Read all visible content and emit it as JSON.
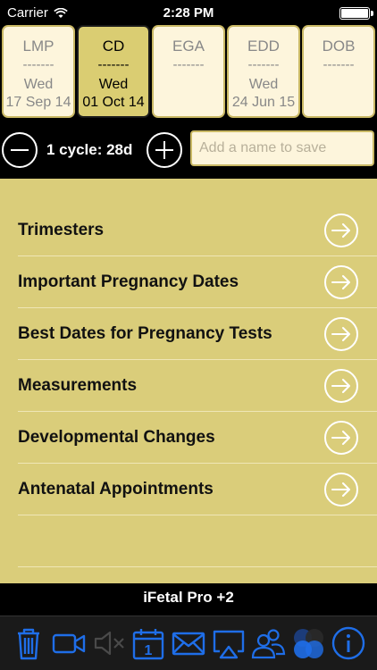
{
  "status_bar": {
    "carrier": "Carrier",
    "time": "2:28 PM"
  },
  "date_tabs": [
    {
      "abbr": "LMP",
      "dash": "-------",
      "day": "Wed",
      "date": "17 Sep 14",
      "active": false
    },
    {
      "abbr": "CD",
      "dash": "-------",
      "day": "Wed",
      "date": "01 Oct 14",
      "active": true
    },
    {
      "abbr": "EGA",
      "dash": "-------",
      "day": "",
      "date": "",
      "active": false
    },
    {
      "abbr": "EDD",
      "dash": "-------",
      "day": "Wed",
      "date": "24 Jun 15",
      "active": false
    },
    {
      "abbr": "DOB",
      "dash": "-------",
      "day": "",
      "date": "",
      "active": false
    }
  ],
  "cycle": {
    "label": "1 cycle: 28d",
    "name_placeholder": "Add a name to save",
    "name_value": ""
  },
  "menu": [
    {
      "label": "Trimesters"
    },
    {
      "label": "Important Pregnancy Dates"
    },
    {
      "label": "Best Dates for Pregnancy Tests"
    },
    {
      "label": "Measurements"
    },
    {
      "label": "Developmental Changes"
    },
    {
      "label": "Antenatal Appointments"
    }
  ],
  "footer": {
    "title": "iFetal Pro +2"
  },
  "toolbar": {
    "icons": [
      "trash-icon",
      "video-icon",
      "mute-icon",
      "calendar-icon",
      "mail-icon",
      "airplay-icon",
      "contacts-icon",
      "circles-icon",
      "info-icon"
    ],
    "calendar_day": "1",
    "accent": "#1f6ee8"
  },
  "colors": {
    "panel": "#dacd7a",
    "tab_bg": "#fdf5dc",
    "tab_active": "#dacd72",
    "tab_border": "#c9b864"
  }
}
